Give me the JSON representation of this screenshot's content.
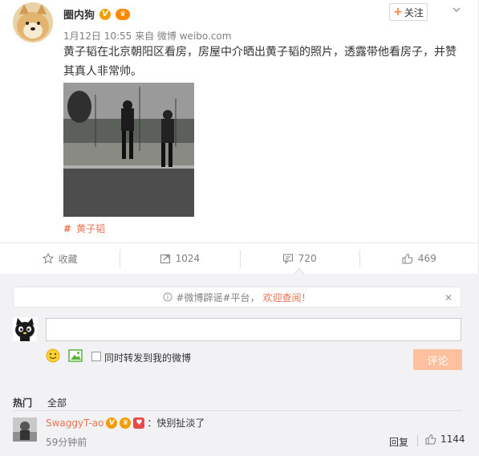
{
  "post": {
    "username": "圈内狗",
    "follow_label": "关注",
    "follow_plus": "+",
    "meta": "1月12日 10:55 来自 微博 weibo.com",
    "text": "黄子韬在北京朝阳区看房，房屋中介晒出黄子韬的照片，透露带他看房子，并赞其真人非常帅。",
    "tag_hash": "#",
    "tag": "黄子韬"
  },
  "actions": {
    "favorite": "收藏",
    "repost": "1024",
    "comment": "720",
    "like": "469"
  },
  "notice": {
    "text": "#微博辟谣#平台，",
    "link": "欢迎查阅！",
    "close": "✕"
  },
  "composer": {
    "input_value": "",
    "forward_label": "同时转发到我的微博",
    "submit_label": "评论"
  },
  "sort": {
    "hot": "热门",
    "all": "全部"
  },
  "comment": {
    "user": "SwaggyT-ao",
    "text": "：快别扯淡了",
    "time": "59分钟前",
    "reply": "回复",
    "likes": "1144"
  },
  "colors": {
    "accent": "#eb7350",
    "badge": "#f59d00",
    "submit_disabled": "#ffc09f"
  }
}
